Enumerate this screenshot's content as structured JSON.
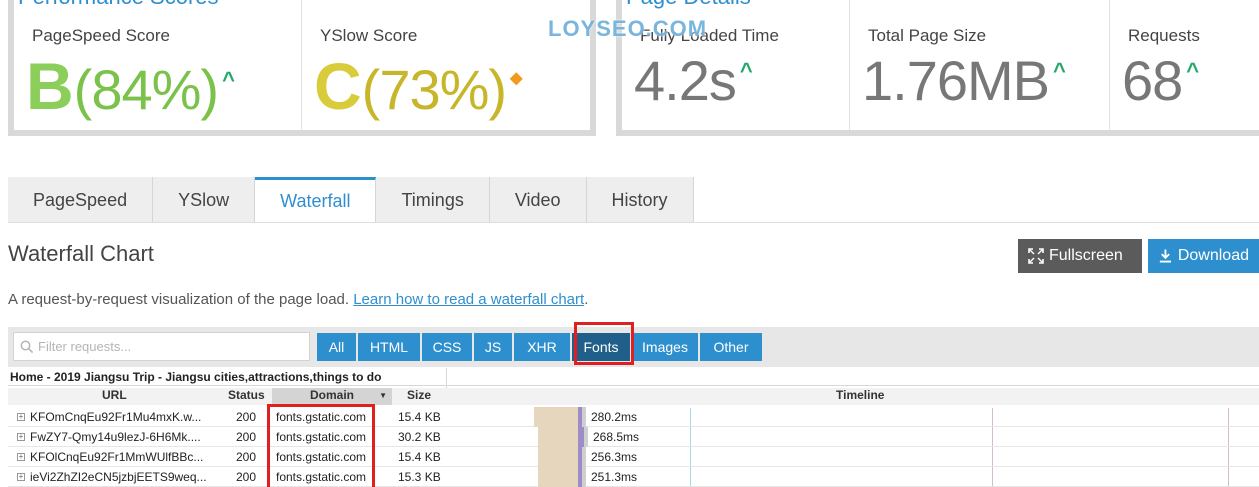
{
  "performance": {
    "title": "Performance Scores",
    "pagespeed_label": "PageSpeed Score",
    "pagespeed_grade": "B",
    "pagespeed_percent": "(84%)",
    "yslow_label": "YSlow Score",
    "yslow_grade": "C",
    "yslow_percent": "(73%)"
  },
  "details": {
    "title": "Page Details",
    "loaded_label": "Fully Loaded Time",
    "loaded_value": "4.2s",
    "size_label": "Total Page Size",
    "size_value": "1.76MB",
    "requests_label": "Requests",
    "requests_value": "68"
  },
  "watermark": "LOYSEO.COM",
  "tabs": [
    "PageSpeed",
    "YSlow",
    "Waterfall",
    "Timings",
    "Video",
    "History"
  ],
  "active_tab": "Waterfall",
  "chart_title": "Waterfall Chart",
  "buttons": {
    "fullscreen": "Fullscreen",
    "download": "Download"
  },
  "description": {
    "text": "A request-by-request visualization of the page load.",
    "link": "Learn how to read a waterfall chart",
    "end": "."
  },
  "filter": {
    "placeholder": "Filter requests...",
    "buttons": [
      "All",
      "HTML",
      "CSS",
      "JS",
      "XHR",
      "Fonts",
      "Images",
      "Other"
    ],
    "active": "Fonts"
  },
  "waterfall": {
    "page_title": "Home - 2019 Jiangsu Trip - Jiangsu cities,attractions,things to do",
    "columns": {
      "url": "URL",
      "status": "Status",
      "domain": "Domain",
      "size": "Size",
      "timeline": "Timeline"
    },
    "rows": [
      {
        "url": "KFOmCnqEu92Fr1Mu4mxK.w...",
        "status": "200",
        "domain": "fonts.gstatic.com",
        "size": "15.4 KB",
        "time": "280.2ms"
      },
      {
        "url": "FwZY7-Qmy14u9lezJ-6H6Mk....",
        "status": "200",
        "domain": "fonts.gstatic.com",
        "size": "30.2 KB",
        "time": "268.5ms"
      },
      {
        "url": "KFOlCnqEu92Fr1MmWUlfBBc...",
        "status": "200",
        "domain": "fonts.gstatic.com",
        "size": "15.4 KB",
        "time": "256.3ms"
      },
      {
        "url": "ieVi2ZhZI2eCN5jzbjEETS9weq...",
        "status": "200",
        "domain": "fonts.gstatic.com",
        "size": "15.3 KB",
        "time": "251.3ms"
      }
    ]
  },
  "colors": {
    "accent": "#2e8fcf",
    "grade_b": "#8bcf5a",
    "grade_c": "#d8cc3a",
    "trend_up": "#27a86b",
    "highlight": "#e02020"
  }
}
